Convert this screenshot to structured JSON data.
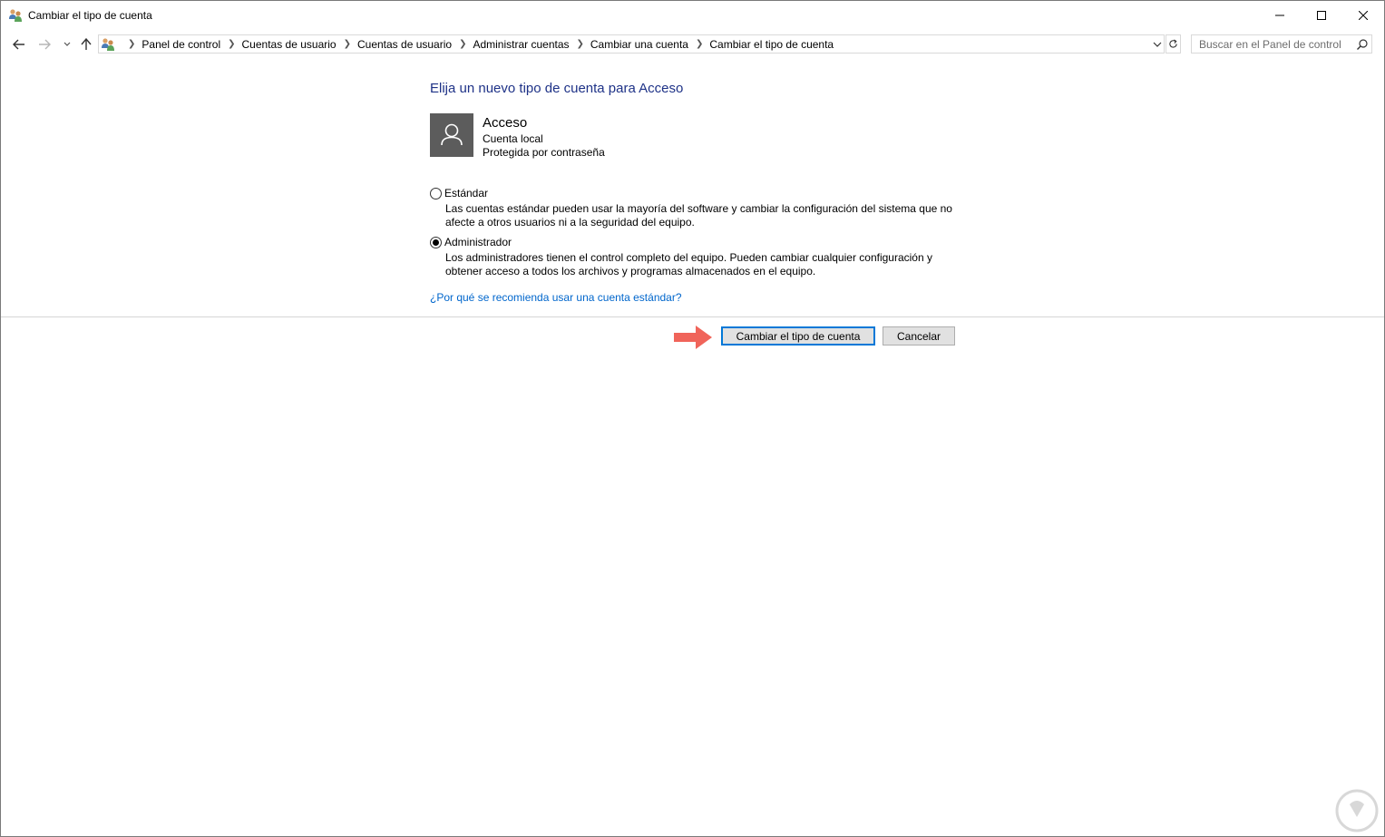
{
  "window": {
    "title": "Cambiar el tipo de cuenta",
    "controls": {
      "minimize": "minimize",
      "maximize": "maximize",
      "close": "close"
    }
  },
  "nav": {
    "breadcrumbs": [
      "Panel de control",
      "Cuentas de usuario",
      "Cuentas de usuario",
      "Administrar cuentas",
      "Cambiar una cuenta",
      "Cambiar el tipo de cuenta"
    ],
    "search_placeholder": "Buscar en el Panel de control"
  },
  "content": {
    "heading": "Elija un nuevo tipo de cuenta para Acceso",
    "account": {
      "name": "Acceso",
      "type": "Cuenta local",
      "protection": "Protegida por contraseña"
    },
    "options": [
      {
        "label": "Estándar",
        "description": "Las cuentas estándar pueden usar la mayoría del software y cambiar la configuración del sistema que no afecte a otros usuarios ni a la seguridad del equipo.",
        "selected": false
      },
      {
        "label": "Administrador",
        "description": "Los administradores tienen el control completo del equipo. Pueden cambiar cualquier configuración y obtener acceso a todos los archivos y programas almacenados en el equipo.",
        "selected": true
      }
    ],
    "help_link": "¿Por qué se recomienda usar una cuenta estándar?"
  },
  "buttons": {
    "change": "Cambiar el tipo de cuenta",
    "cancel": "Cancelar"
  },
  "colors": {
    "heading": "#1e3287",
    "link": "#0066cc",
    "arrow": "#f0645a",
    "primary_border": "#0078d7"
  }
}
